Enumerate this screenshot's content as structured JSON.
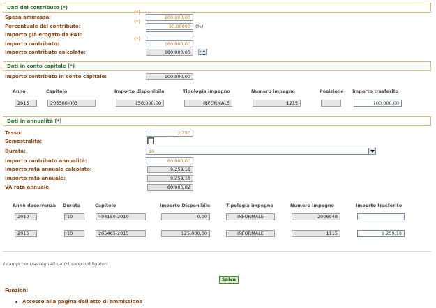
{
  "contributo": {
    "title": "Dati del contributo (*)",
    "spesa_label": "Spesa ammessa:",
    "spesa_value": "200.000,00",
    "perc_label": "Percentuale del contributo:",
    "perc_value": "90,00000",
    "perc_unit": "(%)",
    "erogato_label": "Importo già erogato da PAT:",
    "erogato_value": "",
    "importo_label": "Importo contributo:",
    "importo_value": "180.000,00",
    "calcolato_label": "Importo contributo calcolato:",
    "calcolato_value": "180.000,00",
    "req": "(*)"
  },
  "capitale": {
    "title": "Dati in conto capitale (*)",
    "importo_label": "Importo contributo in conto capitale:",
    "importo_value": "100.000,00",
    "headers": [
      "Anno",
      "Capitolo",
      "Importo disponibile",
      "Tipologia impegno",
      "Numero impegno",
      "Posizione",
      "Importo trasferito"
    ],
    "row": {
      "anno": "2015",
      "capitolo": "205300-003",
      "disponibile": "150.000,00",
      "tipologia": "INFORMALE",
      "numero": "1215",
      "posizione": "",
      "trasferito": "100.000,00"
    }
  },
  "annualita": {
    "title": "Dati in annualità (*)",
    "tasso_label": "Tasso:",
    "tasso_value": "2,750",
    "semestralita_label": "Semestralità:",
    "durata_label": "Durata:",
    "durata_value": "10",
    "importo_ann_label": "Importo contributo annualità:",
    "importo_ann_value": "80.000,00",
    "rata_calc_label": "Importo rata annuale calcolato:",
    "rata_calc_value": "9.259,18",
    "rata_label": "Importo rata annuale:",
    "rata_value": "9.259,18",
    "va_label": "VA rata annuale:",
    "va_value": "80.000,02",
    "headers": [
      "Anno decorrenza",
      "Durata",
      "Capitolo",
      "Importo Disponibile",
      "Tipologia impegno",
      "Numero impegno",
      "Importo trasferito"
    ],
    "rows": [
      {
        "anno": "2010",
        "durata": "10",
        "capitolo": "404150-2010",
        "disponibile": "0,00",
        "tipologia": "INFORMALE",
        "numero": "2006048",
        "trasferito": ""
      },
      {
        "anno": "2015",
        "durata": "10",
        "capitolo": "205465-2015",
        "disponibile": "125.000,00",
        "tipologia": "INFORMALE",
        "numero": "1115",
        "trasferito": "9.259,18"
      }
    ]
  },
  "footer": {
    "note": "I campi contrassegnati da (*) sono obbligatori",
    "save_label": "Salva",
    "funzioni_label": "Funzioni",
    "link_label": "Accesso alla pagina dell'atto di ammissione"
  }
}
